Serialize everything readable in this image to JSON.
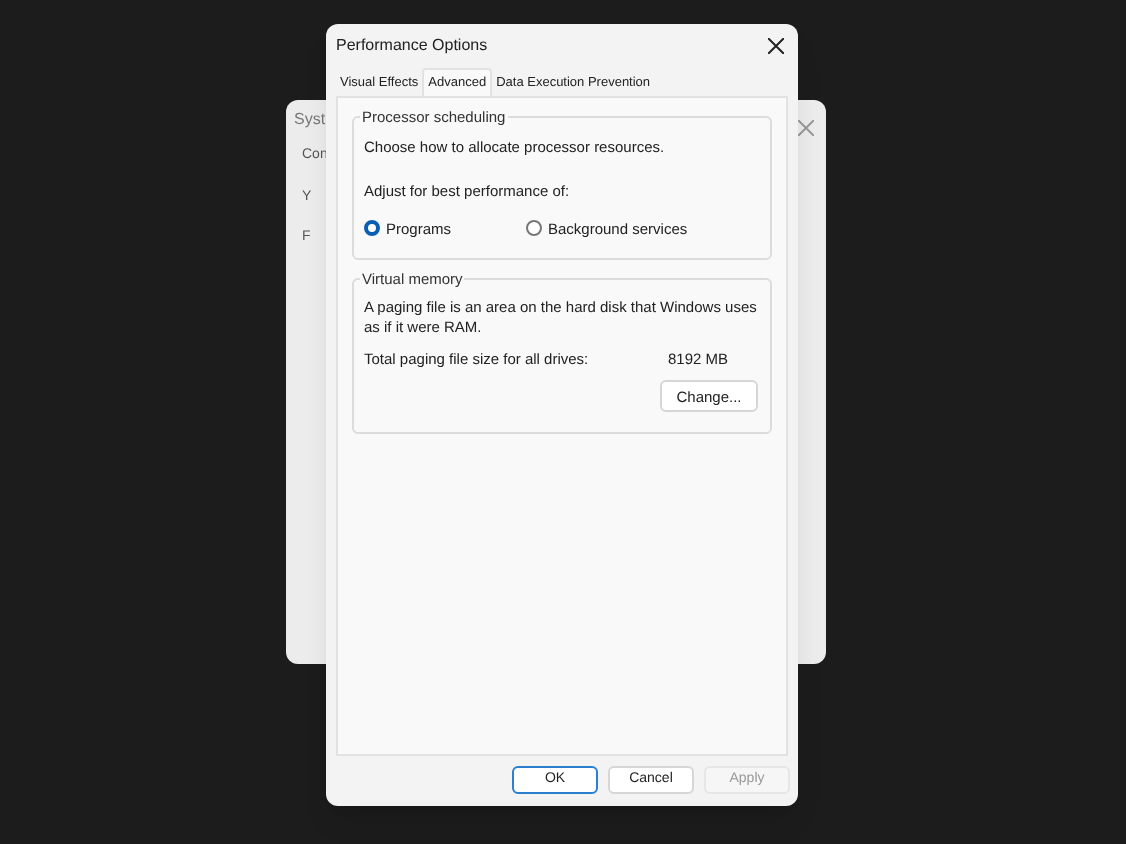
{
  "background_window": {
    "title": "Syst",
    "fragments": [
      "Con",
      "Y",
      "F"
    ]
  },
  "window": {
    "title": "Performance Options"
  },
  "tabs": [
    {
      "label": "Visual Effects",
      "selected": false
    },
    {
      "label": "Advanced",
      "selected": true
    },
    {
      "label": "Data Execution Prevention",
      "selected": false
    }
  ],
  "processor_scheduling": {
    "title": "Processor scheduling",
    "description": "Choose how to allocate processor resources.",
    "prompt": "Adjust for best performance of:",
    "options": [
      {
        "label": "Programs",
        "selected": true
      },
      {
        "label": "Background services",
        "selected": false
      }
    ]
  },
  "virtual_memory": {
    "title": "Virtual memory",
    "description": "A paging file is an area on the hard disk that Windows uses as if it were RAM.",
    "total_label": "Total paging file size for all drives:",
    "total_value": "8192 MB",
    "button": "Change..."
  },
  "buttons": [
    {
      "label": "OK",
      "default": true,
      "disabled": false
    },
    {
      "label": "Cancel",
      "default": false,
      "disabled": false
    },
    {
      "label": "Apply",
      "default": false,
      "disabled": true
    }
  ]
}
